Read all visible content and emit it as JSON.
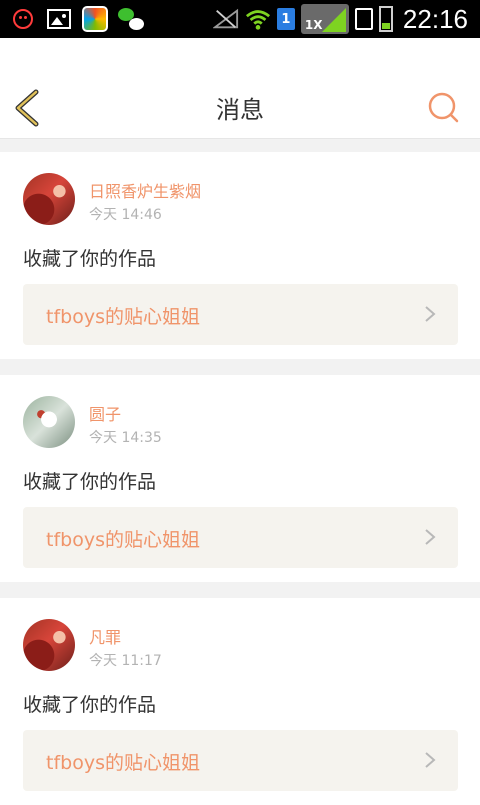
{
  "status_bar": {
    "time": "22:16",
    "sim_label": "1",
    "network_label": "1X",
    "icons": [
      "sad-face-icon",
      "gallery-icon",
      "app-icon",
      "wechat-icon",
      "no-signal-icon",
      "wifi-icon",
      "sim-1-icon",
      "network-1x-icon",
      "sd-card-icon",
      "battery-icon"
    ],
    "battery_level": 0.2
  },
  "header": {
    "title": "消息",
    "back_icon": "back-chevron-icon",
    "search_icon": "search-icon",
    "accent_color": "#f0946a",
    "back_icon_color": "#e0c15a"
  },
  "messages": [
    {
      "username": "日照香炉生紫烟",
      "time": "今天 14:46",
      "action": "收藏了你的作品",
      "work_title": "tfboys的贴心姐姐"
    },
    {
      "username": "圆子",
      "time": "今天 14:35",
      "action": "收藏了你的作品",
      "work_title": "tfboys的贴心姐姐"
    },
    {
      "username": "凡罪",
      "time": "今天 11:17",
      "action": "收藏了你的作品",
      "work_title": "tfboys的贴心姐姐"
    }
  ]
}
